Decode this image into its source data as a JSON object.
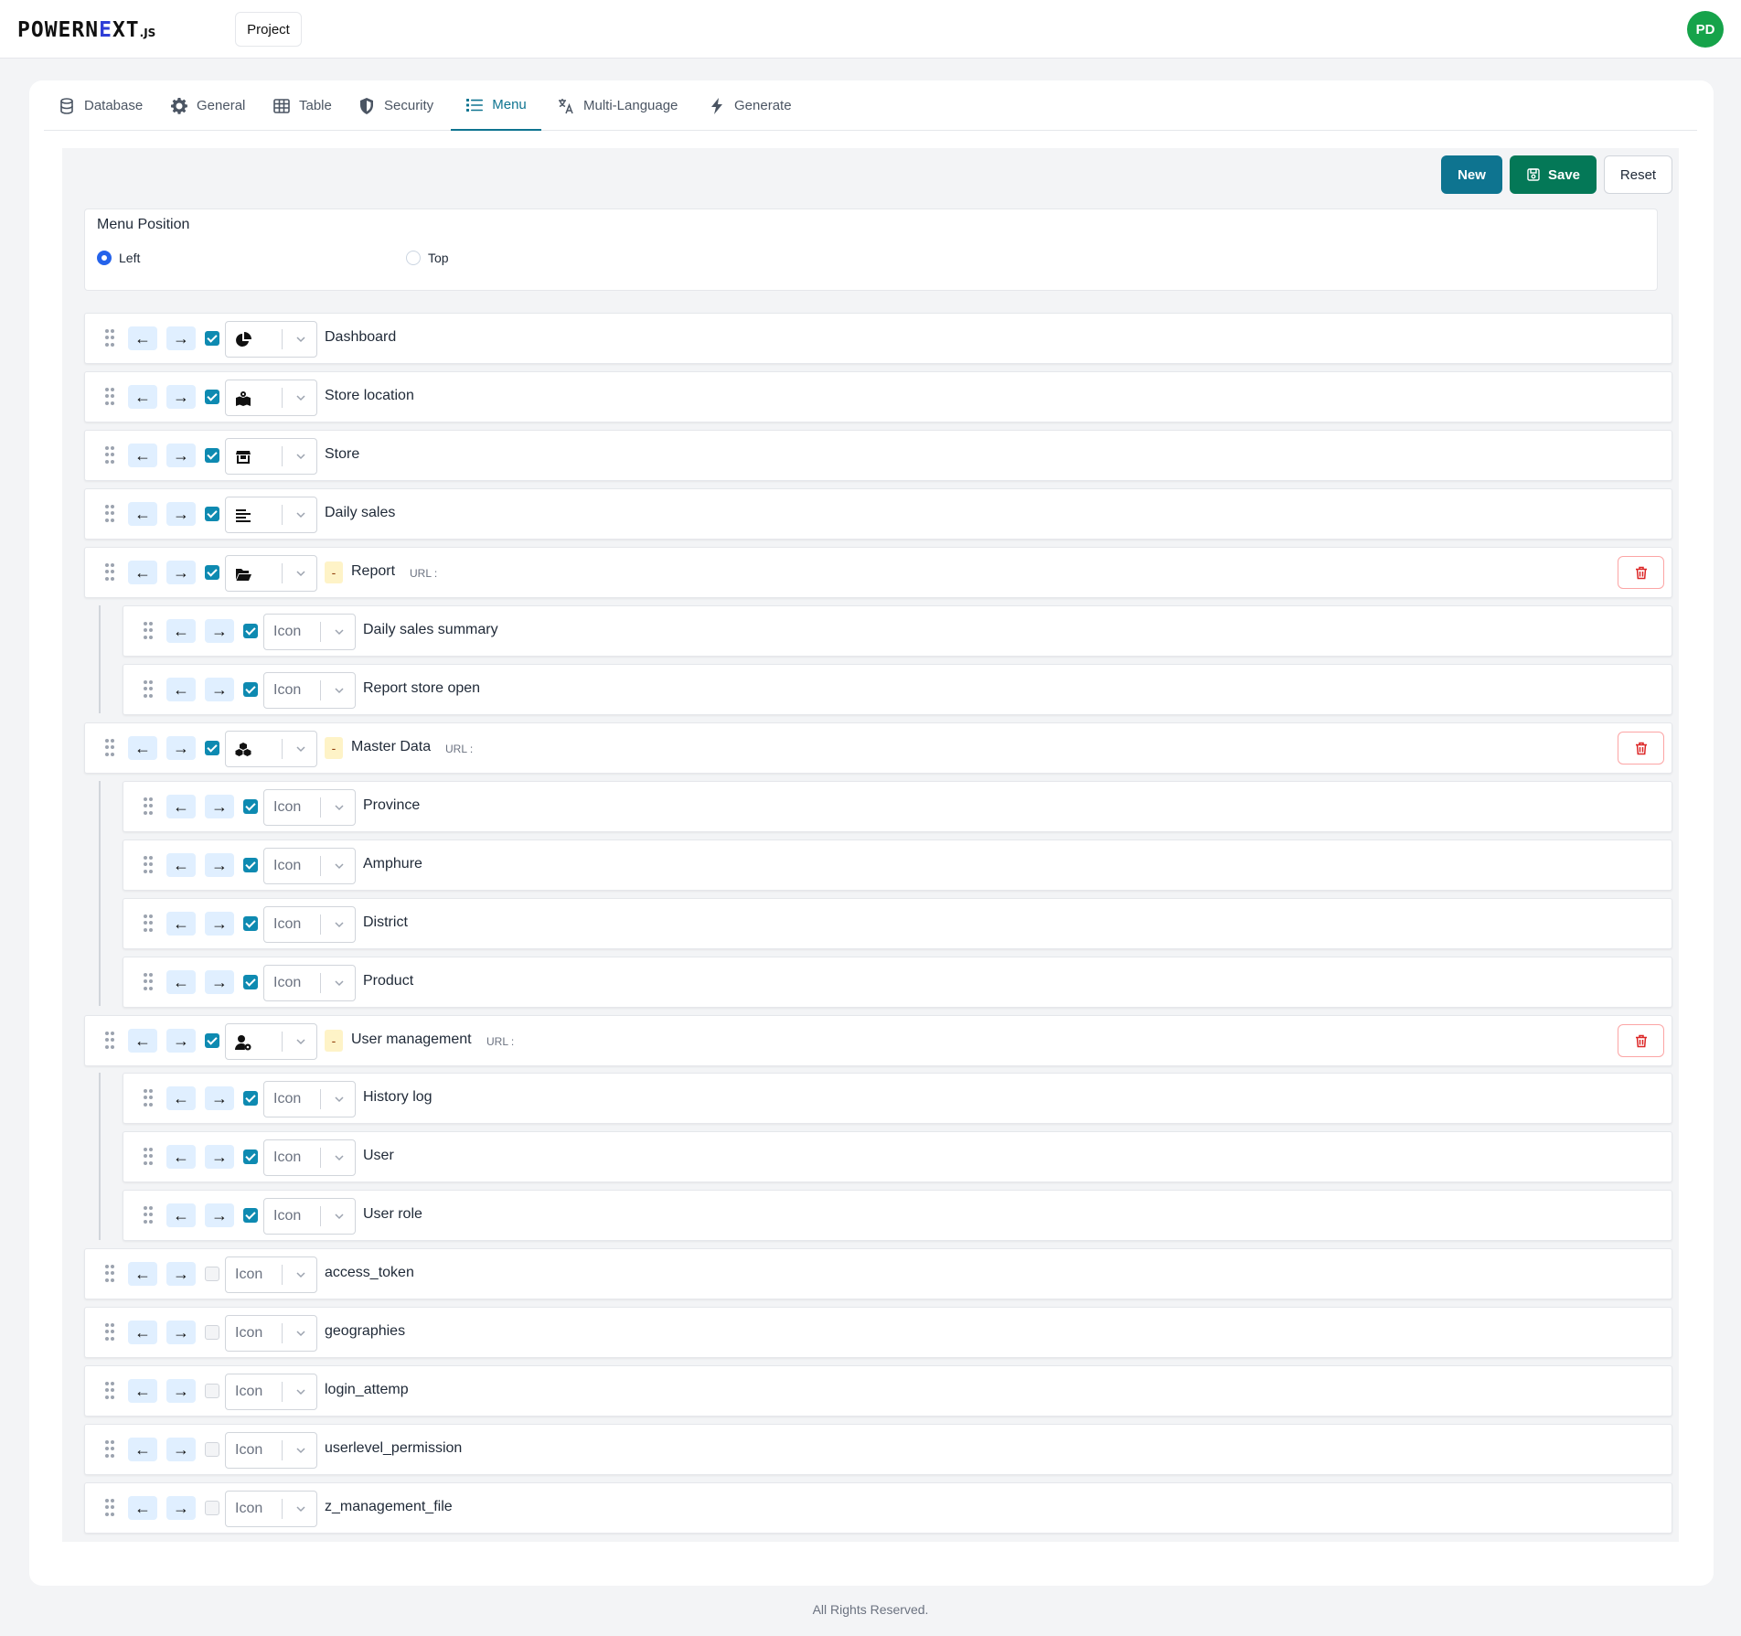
{
  "header": {
    "logo_main": "POWERN",
    "logo_accent": "E",
    "logo_tail": "XT",
    "logo_suffix": ".JS",
    "project_label": "Project",
    "avatar_initials": "PD"
  },
  "tabs": [
    {
      "label": "Database",
      "icon": "database-icon"
    },
    {
      "label": "General",
      "icon": "gear-icon"
    },
    {
      "label": "Table",
      "icon": "table-icon"
    },
    {
      "label": "Security",
      "icon": "shield-icon"
    },
    {
      "label": "Menu",
      "icon": "list-icon",
      "active": true
    },
    {
      "label": "Multi-Language",
      "icon": "translate-icon"
    },
    {
      "label": "Generate",
      "icon": "bolt-icon"
    }
  ],
  "toolbar": {
    "new_label": "New",
    "save_label": "Save",
    "reset_label": "Reset"
  },
  "menu_position": {
    "title": "Menu Position",
    "options": [
      "Left",
      "Top"
    ],
    "selected": "Left"
  },
  "menu_items": [
    {
      "label": "Dashboard",
      "checked": true,
      "icon": "chart-pie-icon"
    },
    {
      "label": "Store location",
      "checked": true,
      "icon": "map-location-icon"
    },
    {
      "label": "Store",
      "checked": true,
      "icon": "shop-icon"
    },
    {
      "label": "Daily sales",
      "checked": true,
      "icon": "align-left-icon"
    },
    {
      "label": "Report",
      "checked": true,
      "icon": "folder-open-icon",
      "group_marker": "-",
      "url_label": "URL :"
    },
    {
      "label": "Daily sales summary",
      "checked": true,
      "placeholder": "Icon"
    },
    {
      "label": "Report store open",
      "checked": true,
      "placeholder": "Icon"
    },
    {
      "label": "Master Data",
      "checked": true,
      "icon": "cubes-icon",
      "group_marker": "-",
      "url_label": "URL :"
    },
    {
      "label": "Province",
      "checked": true,
      "placeholder": "Icon"
    },
    {
      "label": "Amphure",
      "checked": true,
      "placeholder": "Icon"
    },
    {
      "label": "District",
      "checked": true,
      "placeholder": "Icon"
    },
    {
      "label": "Product",
      "checked": true,
      "placeholder": "Icon"
    },
    {
      "label": "User management",
      "checked": true,
      "icon": "user-gear-icon",
      "group_marker": "-",
      "url_label": "URL :"
    },
    {
      "label": "History log",
      "checked": true,
      "placeholder": "Icon"
    },
    {
      "label": "User",
      "checked": true,
      "placeholder": "Icon"
    },
    {
      "label": "User role",
      "checked": true,
      "placeholder": "Icon"
    },
    {
      "label": "access_token",
      "checked": false,
      "placeholder": "Icon"
    },
    {
      "label": "geographies",
      "checked": false,
      "placeholder": "Icon"
    },
    {
      "label": "login_attemp",
      "checked": false,
      "placeholder": "Icon"
    },
    {
      "label": "userlevel_permission",
      "checked": false,
      "placeholder": "Icon"
    },
    {
      "label": "z_management_file",
      "checked": false,
      "placeholder": "Icon"
    }
  ],
  "arrows": {
    "left": "←",
    "right": "→"
  },
  "footer": {
    "text": "All Rights Reserved."
  }
}
